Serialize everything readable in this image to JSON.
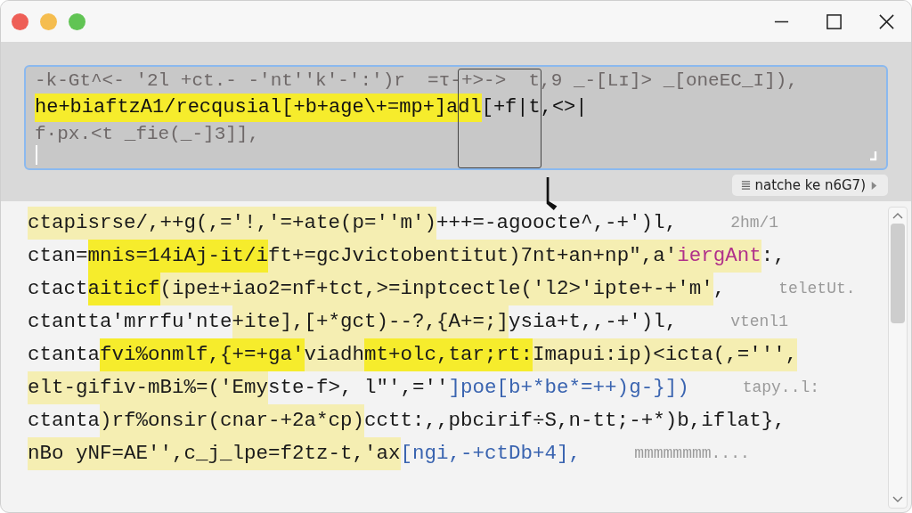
{
  "window": {
    "lights": [
      {
        "color": "#ee5f57"
      },
      {
        "color": "#f5bd4f"
      },
      {
        "color": "#61c454"
      }
    ],
    "controls": [
      {
        "kind": "minimize"
      },
      {
        "kind": "maximize"
      },
      {
        "kind": "close"
      }
    ]
  },
  "search_overlay": {
    "ghost_above": "-k-Gt^<- '2l +ct.- -'nt''k'-':')r  =τ-+>->  t,9 _-[Lɪ]> _[oneEC_I]),",
    "query": [
      {
        "text": "he+biaftzA1/recqusial[+b+age\\+=mp+",
        "match": true,
        "current": true
      },
      {
        "text": "]adl",
        "match": true,
        "current": true
      },
      {
        "text": "[+f|t,<>|",
        "match": false
      }
    ],
    "ghost_below": "f·px.<t _fie(_-]3]],"
  },
  "match_badge": {
    "text": "natche ke n6G7)"
  },
  "code_lines": [
    {
      "segments": [
        {
          "text": "ctapisrse/,++g(,='!,'=+ate(p=''m')",
          "match": true,
          "current": false
        },
        {
          "text": "+++=-agoocte^,-+')l,",
          "match": false
        }
      ],
      "ghost": "2hm/1"
    },
    {
      "segments": [
        {
          "text": "ctan=",
          "match": false
        },
        {
          "text": "mnis=14iAj-it/i",
          "match": true,
          "current": true
        },
        {
          "text": "ft+=gcJvictobentitut)",
          "match": true,
          "current": false
        },
        {
          "text": "7nt+an+np\",a'",
          "match": true,
          "current": false
        },
        {
          "text": "iergAnt",
          "match": true,
          "current": false,
          "color": "#b0308a"
        },
        {
          "text": ":,",
          "match": false
        }
      ]
    },
    {
      "segments": [
        {
          "text": "ctact",
          "match": false
        },
        {
          "text": "aiticf",
          "match": true,
          "current": true
        },
        {
          "text": "(ipe±+iao2=nf+tct,>=inptcectle('l2>'ipte+-+'m'",
          "match": true,
          "current": false
        },
        {
          "text": ",",
          "match": false
        }
      ],
      "ghost": "teletUt."
    },
    {
      "segments": [
        {
          "text": "ctantta'mrrfu'nte",
          "match": false
        },
        {
          "text": "+ite],[+*gct)--?,{A+=;]",
          "match": true,
          "current": false
        },
        {
          "text": "ysia+t,,-+')l,",
          "match": false
        }
      ],
      "ghost": "vtenl1"
    },
    {
      "segments": [
        {
          "text": "ctanta",
          "match": false
        },
        {
          "text": "fvi%onmlf,{+=+ga'",
          "match": true,
          "current": true
        },
        {
          "text": "viadh",
          "match": true,
          "current": false
        },
        {
          "text": "mt+olc,tar;rt:",
          "match": true,
          "current": true
        },
        {
          "text": "Imapui:ip)<icta(,=''',",
          "match": true,
          "current": false
        }
      ]
    },
    {
      "segments": [
        {
          "text": "elt-gifiv-mBi%=('Emy",
          "match": true,
          "current": false
        },
        {
          "text": "ste-f>, l\"',=''",
          "match": false
        },
        {
          "text": "]poe[b+*be*=++)g-}])",
          "match": false,
          "color": "#3a64b0"
        }
      ],
      "ghost": "tapy..l:"
    },
    {
      "segments": [
        {
          "text": "ctanta",
          "match": false
        },
        {
          "text": ")rf%onsir(cnar-+2a*cp)",
          "match": true,
          "current": false
        },
        {
          "text": "cctt:,,pbcirif÷S,n-tt;-+*)b,iflat},",
          "match": false
        }
      ]
    },
    {
      "segments": [
        {
          "text": "nBo yNF=AE'',c_j_lpe=f2tz-t,'ax",
          "match": true,
          "current": false
        },
        {
          "text": "[ngi,-+ctDb+4],",
          "match": false,
          "color": "#3a64b0"
        }
      ],
      "ghost": "mmmmmmmm...."
    }
  ]
}
